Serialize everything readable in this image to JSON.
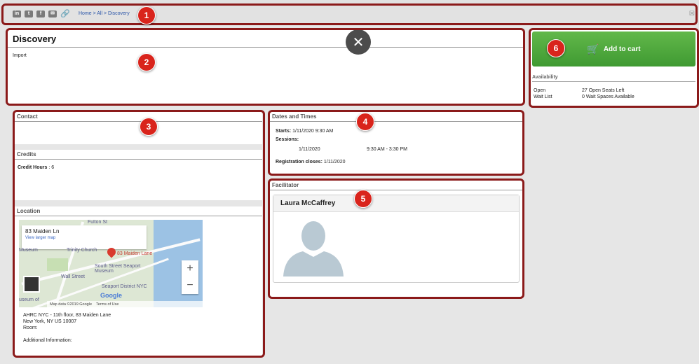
{
  "topbar": {
    "share_icons": [
      "linkedin-icon",
      "twitter-icon",
      "facebook-icon",
      "email-icon",
      "link-icon"
    ],
    "breadcrumb": "Home > All > Discovery"
  },
  "course": {
    "title": "Discovery",
    "description": "Import"
  },
  "cart": {
    "label": "Add to cart"
  },
  "availability": {
    "title": "Availability",
    "rows": [
      {
        "label": "Open",
        "value": "27 Open Seats Left"
      },
      {
        "label": "Wait List",
        "value": "0 Wait Spaces Available"
      }
    ]
  },
  "contact": {
    "title": "Contact"
  },
  "credits": {
    "title": "Credits",
    "label": "Credit Hours",
    "value": ": 6"
  },
  "location": {
    "title": "Location",
    "map_card_title": "83 Maiden Ln",
    "map_card_link": "View larger map",
    "map_labels": [
      "Fulton St",
      "Trinity Church",
      "83 Maiden Lane",
      "South Street Seaport Museum",
      "Wall Street",
      "Seaport District NYC",
      "Museum",
      "useum of"
    ],
    "map_attribution": "Map data ©2019 Google",
    "map_terms": "Terms of Use",
    "map_logo": "Google",
    "address_line1": "AHRC NYC - 11th floor, 83 Maiden Lane",
    "address_line2": "New York, NY US 10007",
    "room": "Room:",
    "additional": "Additional Information:"
  },
  "dates": {
    "title": "Dates and Times",
    "starts_label": "Starts:",
    "starts_value": "1/11/2020  9:30 AM",
    "sessions_label": "Sessions:",
    "session_date": "1/11/2020",
    "session_time": "9:30 AM - 3:30 PM",
    "reg_label": "Registration closes:",
    "reg_value": "1/11/2020"
  },
  "facilitator": {
    "title": "Facilitator",
    "name": "Laura  McCaffrey"
  },
  "badges": [
    "1",
    "2",
    "3",
    "4",
    "5",
    "6"
  ],
  "colors": {
    "highlight": "#8b1a1a",
    "badge": "#d9241c",
    "cart": "#4ca83a",
    "link": "#2a55a8"
  }
}
